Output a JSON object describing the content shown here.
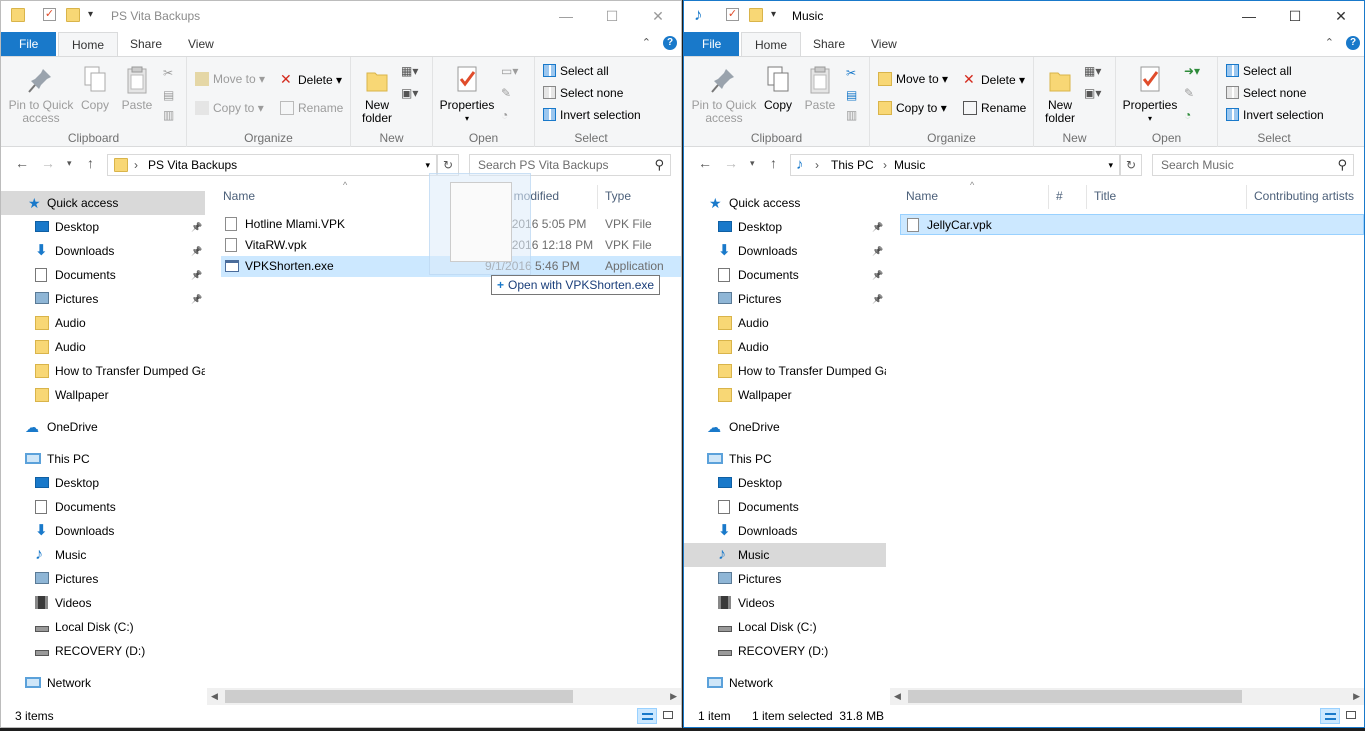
{
  "left": {
    "title": "PS Vita Backups",
    "tabs": [
      "File",
      "Home",
      "Share",
      "View"
    ],
    "ribbon": {
      "clipboard": {
        "label": "Clipboard",
        "pin": "Pin to Quick access",
        "copy": "Copy",
        "paste": "Paste"
      },
      "organize": {
        "label": "Organize",
        "move_to": "Move to",
        "copy_to": "Copy to",
        "delete": "Delete",
        "rename": "Rename"
      },
      "new": {
        "label": "New",
        "new_folder": "New folder"
      },
      "open": {
        "label": "Open",
        "properties": "Properties"
      },
      "select": {
        "label": "Select",
        "select_all": "Select all",
        "select_none": "Select none",
        "invert": "Invert selection"
      }
    },
    "address": {
      "crumbs": [
        "PS Vita Backups"
      ],
      "search_placeholder": "Search PS Vita Backups"
    },
    "columns": [
      "Name",
      "Date modified",
      "Type"
    ],
    "files": [
      {
        "name": "Hotline Mlami.VPK",
        "date": "8/31/2016 5:05 PM",
        "type": "VPK File",
        "icon": "file-icon",
        "selected": false
      },
      {
        "name": "VitaRW.vpk",
        "date": "8/22/2016 12:18 PM",
        "type": "VPK File",
        "icon": "file-icon",
        "selected": false
      },
      {
        "name": "VPKShorten.exe",
        "date": "9/1/2016 5:46 PM",
        "type": "Application",
        "icon": "exe-icon",
        "selected": true
      }
    ],
    "status": "3 items",
    "drop_tip": "Open with VPKShorten.exe"
  },
  "right": {
    "title": "Music",
    "tabs": [
      "File",
      "Home",
      "Share",
      "View"
    ],
    "ribbon": {
      "clipboard": {
        "label": "Clipboard",
        "pin": "Pin to Quick access",
        "copy": "Copy",
        "paste": "Paste"
      },
      "organize": {
        "label": "Organize",
        "move_to": "Move to",
        "copy_to": "Copy to",
        "delete": "Delete",
        "rename": "Rename"
      },
      "new": {
        "label": "New",
        "new_folder": "New folder"
      },
      "open": {
        "label": "Open",
        "properties": "Properties"
      },
      "select": {
        "label": "Select",
        "select_all": "Select all",
        "select_none": "Select none",
        "invert": "Invert selection"
      }
    },
    "address": {
      "crumbs": [
        "This PC",
        "Music"
      ],
      "search_placeholder": "Search Music"
    },
    "columns": [
      "Name",
      "#",
      "Title",
      "Contributing artists"
    ],
    "files": [
      {
        "name": "JellyCar.vpk",
        "icon": "file-icon",
        "selected": true
      }
    ],
    "status": "1 item",
    "status_selected": "1 item selected  31.8 MB"
  },
  "nav": {
    "quick_access": "Quick access",
    "items": [
      {
        "label": "Desktop",
        "icon": "desktop-icon",
        "pinned": true
      },
      {
        "label": "Downloads",
        "icon": "downloads-icon",
        "pinned": true
      },
      {
        "label": "Documents",
        "icon": "documents-icon",
        "pinned": true
      },
      {
        "label": "Pictures",
        "icon": "pictures-icon",
        "pinned": true
      },
      {
        "label": "Audio",
        "icon": "folder-icon",
        "pinned": false
      },
      {
        "label": "Audio",
        "icon": "folder-icon",
        "pinned": false
      },
      {
        "label": "How to Transfer Dumped Ga",
        "icon": "folder-icon",
        "pinned": false
      },
      {
        "label": "Wallpaper",
        "icon": "folder-icon",
        "pinned": false
      }
    ],
    "onedrive": "OneDrive",
    "this_pc": "This PC",
    "pc_items": [
      {
        "label": "Desktop",
        "icon": "desktop-icon"
      },
      {
        "label": "Documents",
        "icon": "documents-icon"
      },
      {
        "label": "Downloads",
        "icon": "downloads-icon"
      },
      {
        "label": "Music",
        "icon": "music-icon"
      },
      {
        "label": "Pictures",
        "icon": "pictures-icon"
      },
      {
        "label": "Videos",
        "icon": "videos-icon"
      },
      {
        "label": "Local Disk (C:)",
        "icon": "drive-icon"
      },
      {
        "label": "RECOVERY (D:)",
        "icon": "drive-icon"
      }
    ],
    "network": "Network"
  },
  "colors": {
    "accent": "#1979ca",
    "selection": "#cce8ff",
    "folder": "#f8d775"
  }
}
